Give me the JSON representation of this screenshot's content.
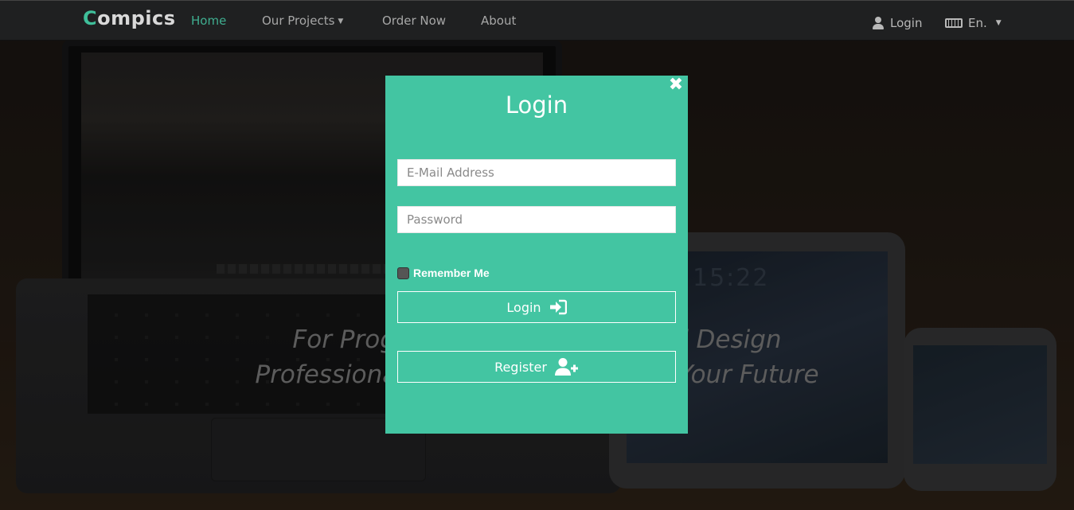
{
  "navbar": {
    "brand_first_letter": "C",
    "brand_rest": "ompics",
    "links": [
      {
        "label": "Home",
        "active": true
      },
      {
        "label": "Our Projects",
        "has_dropdown": true
      },
      {
        "label": "Order Now"
      },
      {
        "label": "About"
      }
    ],
    "login_label": "Login",
    "language_label": "En."
  },
  "hero": {
    "line1": "For Programming Company And Design",
    "line2": "Professional Creative For You And Your Future"
  },
  "modal": {
    "title": "Login",
    "email_placeholder": "E-Mail Address",
    "password_placeholder": "Password",
    "remember_label": "Remember Me",
    "remember_checked": false,
    "login_button": "Login",
    "register_button": "Register"
  },
  "colors": {
    "accent": "#43c5a2",
    "brand_accent": "#3fbf9a",
    "navbar_bg": "#1f2021"
  },
  "icons": {
    "close": "close-icon",
    "user": "user-icon",
    "keyboard": "keyboard-icon",
    "sign_in": "sign-in-icon",
    "user_plus": "user-plus-icon"
  }
}
